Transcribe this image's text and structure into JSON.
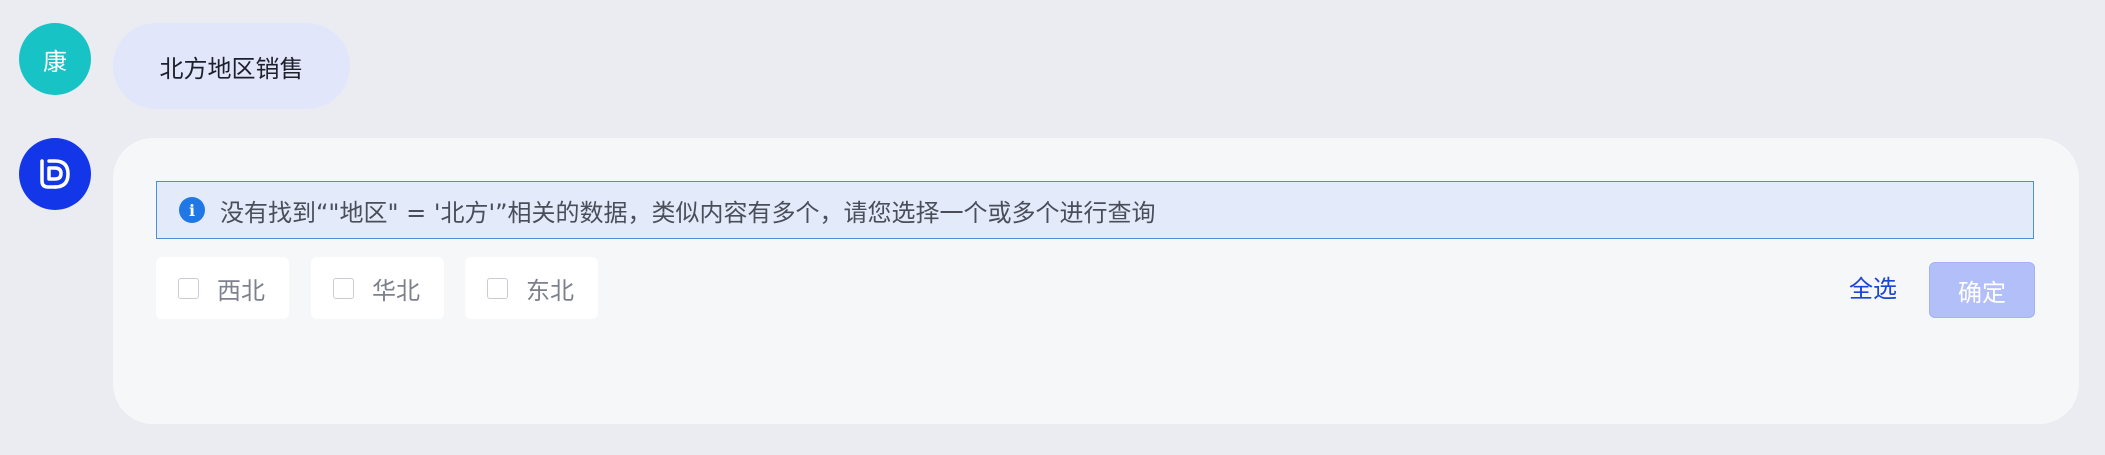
{
  "user": {
    "avatar_text": "康",
    "message": "北方地区销售"
  },
  "bot": {
    "avatar_icon": "bot-logo-icon",
    "notice": {
      "icon": "info-icon",
      "icon_text": "i",
      "text": "没有找到“\"地区\" = '北方'”相关的数据，类似内容有多个，请您选择一个或多个进行查询"
    },
    "options": [
      {
        "label": "西北",
        "checked": false
      },
      {
        "label": "华北",
        "checked": false
      },
      {
        "label": "东北",
        "checked": false
      }
    ],
    "select_all_label": "全选",
    "confirm_label": "确定",
    "confirm_disabled": true
  },
  "colors": {
    "page_bg": "#ebecf1",
    "user_avatar": "#17c3c4",
    "user_bubble": "#e2e6fb",
    "bot_avatar": "#1336e8",
    "notice_bg": "#e3ebfa",
    "notice_border": "#4d8fd9",
    "link": "#1a45d6",
    "confirm_disabled": "#b3bff9"
  }
}
